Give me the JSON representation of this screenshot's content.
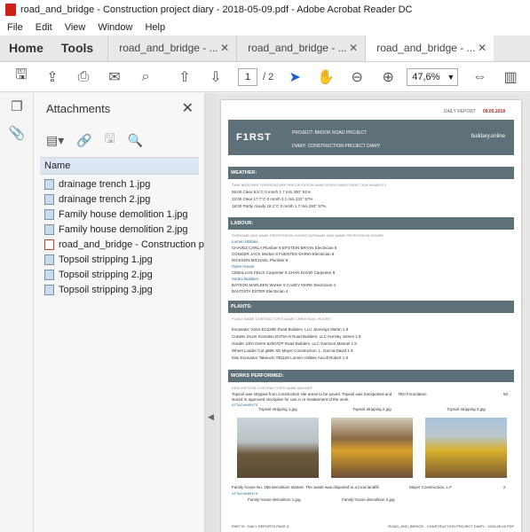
{
  "window": {
    "title": "road_and_bridge - Construction project diary - 2018-05-09.pdf - Adobe Acrobat Reader DC"
  },
  "menu": [
    "File",
    "Edit",
    "View",
    "Window",
    "Help"
  ],
  "tabs": {
    "home": "Home",
    "tools": "Tools",
    "docs": [
      "road_and_bridge - ...",
      "road_and_bridge - ...",
      "road_and_bridge - ..."
    ]
  },
  "toolbar": {
    "page_current": "1",
    "page_total": "/ 2",
    "zoom": "47,6%"
  },
  "attachments": {
    "title": "Attachments",
    "column_name": "Name",
    "items": [
      {
        "name": "drainage trench 1.jpg",
        "type": "image"
      },
      {
        "name": "drainage trench 2.jpg",
        "type": "image"
      },
      {
        "name": "Family house demolition 1.jpg",
        "type": "image"
      },
      {
        "name": "Family house demolition 2.jpg",
        "type": "image"
      },
      {
        "name": "road_and_bridge - Construction proje...",
        "type": "pdf"
      },
      {
        "name": "Topsoil stripping 1.jpg",
        "type": "image"
      },
      {
        "name": "Topsoil stripping 2.jpg",
        "type": "image"
      },
      {
        "name": "Topsoil stripping 3.jpg",
        "type": "image"
      }
    ]
  },
  "doc": {
    "report_label": "DAILY REPORT",
    "report_date": "09.05.2018",
    "logo": "F1RST",
    "project": "PROJECT:  BROOK ROAD PROJECT",
    "diary": "DIARY:  CONSTRUCTION PROJECT DIARY",
    "site": "buildary.online",
    "weather_title": "WEATHER:",
    "weather_header": "TIME        WEATHER        TEMPERATURE        PRECIPITATION        WIND SPEED        WIND DIRECTION        HUMIDITY",
    "weather_rows": [
      "06:00      Clear                     9.5°C                 0 mm/h                1.7 m/s                 300°                  91%",
      "12:00      Clear                    17.7°C                0 mm/h                3.1 m/s                 231°                  57%",
      "18:00      Partly cloudy          18.1°C                0 mm/h                1.7 m/s                 293°                  57%"
    ],
    "labour_title": "LABOUR:",
    "labour_header": "SURNAME AND NAME      PROFESSION        HOURS    SURNAME AND NAME      PROFESSION        HOURS",
    "labour_rows": [
      "Lumen Utilities",
      "CHAVEZ CARLA              Plumber               8    EPSTEIN BRYAN         Electrician          8",
      "CONGER JACK                Worker                 8    FUENTES DARIO         Electrician          8",
      "DICKSON MICHAEL           Plumber               8",
      "Open House",
      "CEBALLOS FELIX             Carpenter              8    CHAN DAVID               Carpenter           8",
      "Vortex Builders",
      "BATSON MARLEEN          Worker                 8    CASEY MARK              Electrician          4",
      "BAUTISTA ESTER             Electrician            4"
    ],
    "plants_title": "PLANTS:",
    "plants_header": "PLANT NAME                              CONTRACTOR'S NAME                      CREW                             NUM.   HOURS",
    "plants_rows": [
      "Excavator Volvo EC220E             Road Builders, LLC                  Jennings Martin                  1      8",
      "Crawler Dozer Komatsu D375A-8   Road Builders, LLC                  Horsley James                    1      8",
      "Grader John Deere 620G/GP        Road Builders, LLC                  Garrison Manuel                  1      8",
      "Wheel Loader Cat g88K XE          Mayer Construction, L.                Garcia David                       1      6",
      "Mini Excavator Takeuchi TB1150   Lumen Utilities                        Ascoll Robert                       1      8"
    ],
    "works_title": "WORKS PERFORMED:",
    "works_header": "DESCRIPTION                                                                                   CONTRACTOR'S NAME               AMOUNT",
    "works_text1": "Topsoil was stripped from construction site areas to be paved. Topsoil was transported and",
    "works_text1b": "stored in approved stockpiles for use in re-instatement of the work.",
    "works_contractor1": "RDI Foundation",
    "works_amount1": "50",
    "attachments_label": "ATTACHMENTS",
    "photo_captions": [
      "Topsoil stripping 1.jpg",
      "Topsoil stripping 2.jpg",
      "Topsoil stripping 3.jpg"
    ],
    "works_text2": "Family house No. 158 demolition started. The waste was disposed to a local landfill.",
    "works_contractor2": "Mayer Construction, L.F.",
    "works_amount2": "2",
    "photo_captions2": [
      "Family house demolition 1.jpg",
      "Family house demolition 2.jpg"
    ],
    "footer_left": "PART B - DAILY REPORTS    PAGE 8",
    "footer_right": "ROAD_AND_BRIDGE - CONSTRUCTION PROJECT DIARY - 2018-05-09.PDF"
  }
}
